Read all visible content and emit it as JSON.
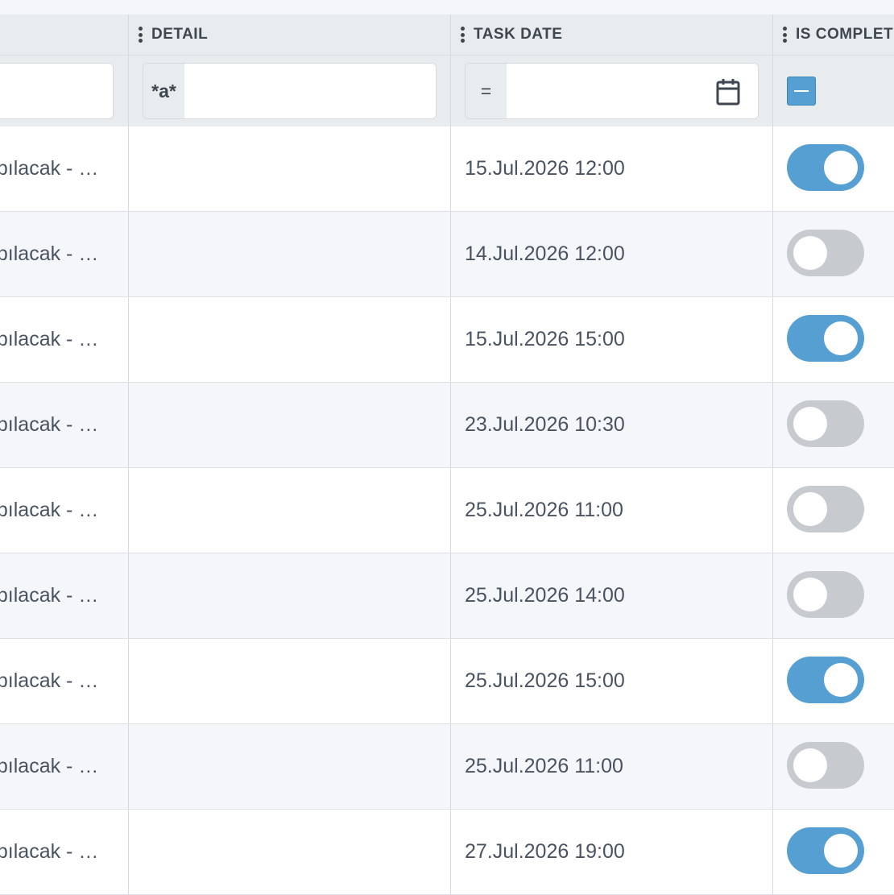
{
  "columns": {
    "detail": "DETAIL",
    "task_date": "TASK DATE",
    "is_completed": "IS COMPLET"
  },
  "filters": {
    "detail_prefix": "*a*",
    "task_date_prefix": "=",
    "detail_value": "",
    "task_date_value": "",
    "is_completed_state": "indeterminate"
  },
  "rows": [
    {
      "title": "apılacak - …",
      "detail": "",
      "task_date": "15.Jul.2026 12:00",
      "is_completed": true
    },
    {
      "title": "apılacak - …",
      "detail": "",
      "task_date": "14.Jul.2026 12:00",
      "is_completed": false
    },
    {
      "title": "apılacak - …",
      "detail": "",
      "task_date": "15.Jul.2026 15:00",
      "is_completed": true
    },
    {
      "title": "apılacak - …",
      "detail": "",
      "task_date": "23.Jul.2026 10:30",
      "is_completed": false
    },
    {
      "title": "apılacak - …",
      "detail": "",
      "task_date": "25.Jul.2026 11:00",
      "is_completed": false
    },
    {
      "title": "apılacak - …",
      "detail": "",
      "task_date": "25.Jul.2026 14:00",
      "is_completed": false
    },
    {
      "title": "apılacak - …",
      "detail": "",
      "task_date": "25.Jul.2026 15:00",
      "is_completed": true
    },
    {
      "title": "apılacak - …",
      "detail": "",
      "task_date": "25.Jul.2026 11:00",
      "is_completed": false
    },
    {
      "title": "apılacak - …",
      "detail": "",
      "task_date": "27.Jul.2026 19:00",
      "is_completed": true
    }
  ],
  "colors": {
    "toggle_on": "#569fd3",
    "toggle_off": "#c7cbcf",
    "header_bg": "#e9ecef"
  },
  "icons": {
    "column_menu": "kebab-icon",
    "date_picker": "calendar-icon"
  }
}
